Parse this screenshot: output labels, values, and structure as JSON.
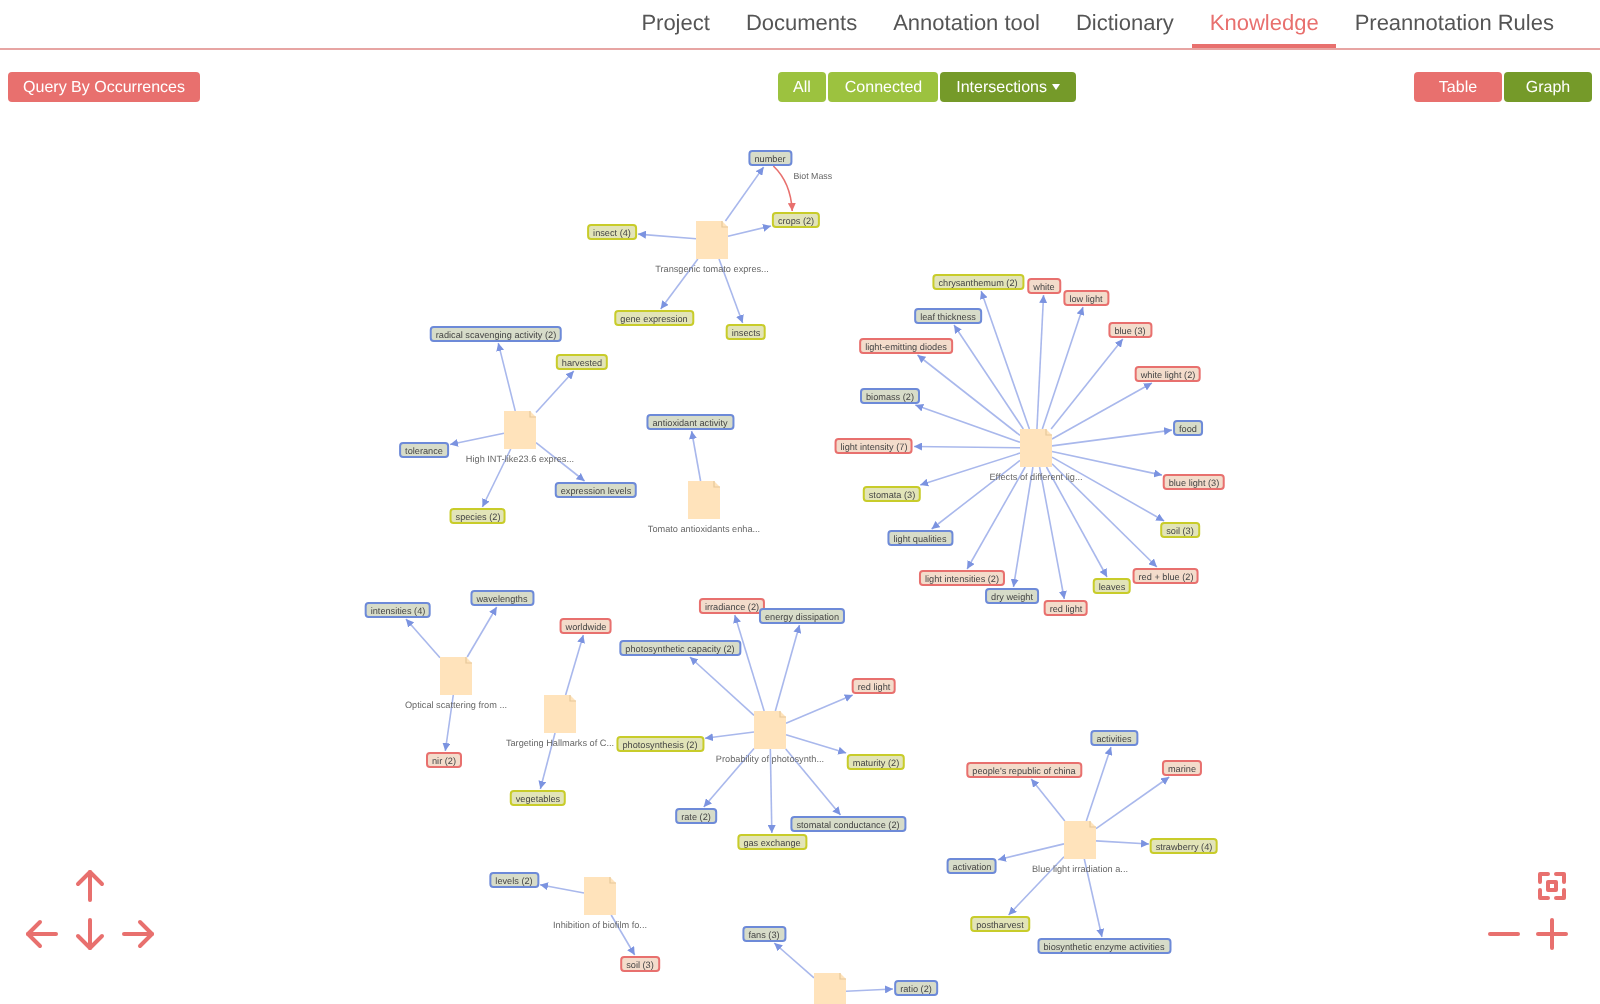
{
  "nav": {
    "tabs": [
      {
        "label": "Project",
        "selected": false
      },
      {
        "label": "Documents",
        "selected": false
      },
      {
        "label": "Annotation tool",
        "selected": false
      },
      {
        "label": "Dictionary",
        "selected": false
      },
      {
        "label": "Knowledge",
        "selected": true
      },
      {
        "label": "Preannotation Rules",
        "selected": false
      }
    ]
  },
  "toolbar": {
    "query_button": "Query By Occurrences",
    "filters": [
      {
        "label": "All",
        "selected": false,
        "dropdown": false
      },
      {
        "label": "Connected",
        "selected": false,
        "dropdown": false
      },
      {
        "label": "Intersections",
        "selected": true,
        "dropdown": true
      }
    ],
    "views": [
      {
        "label": "Table",
        "selected": false
      },
      {
        "label": "Graph",
        "selected": true
      }
    ]
  },
  "graph": {
    "documents": [
      {
        "caption": "Transgenic tomato expres...",
        "tags": [
          {
            "label": "number",
            "color": "#6d8ad8"
          },
          {
            "label": "crops (2)",
            "color": "#c8cc2a"
          },
          {
            "label": "insect (4)",
            "color": "#c8cc2a"
          },
          {
            "label": "gene expression",
            "color": "#c8cc2a"
          },
          {
            "label": "insects",
            "color": "#c8cc2a"
          }
        ],
        "links": [
          {
            "label": "Biot Mass"
          }
        ]
      },
      {
        "caption": "High INT-like23.6 expres...",
        "tags": [
          {
            "label": "radical scavenging activity (2)",
            "color": "#6d8ad8"
          },
          {
            "label": "harvested",
            "color": "#c8cc2a"
          },
          {
            "label": "tolerance",
            "color": "#6d8ad8"
          },
          {
            "label": "expression levels",
            "color": "#6d8ad8"
          },
          {
            "label": "species (2)",
            "color": "#c8cc2a"
          }
        ]
      },
      {
        "caption": "Tomato antioxidants enha...",
        "tags": [
          {
            "label": "antioxidant activity",
            "color": "#6d8ad8"
          }
        ]
      },
      {
        "caption": "Effects of different lig...",
        "tags": [
          {
            "label": "chrysanthemum (2)",
            "color": "#c8cc2a"
          },
          {
            "label": "white",
            "color": "#e8706e"
          },
          {
            "label": "low light",
            "color": "#e8706e"
          },
          {
            "label": "leaf thickness",
            "color": "#6d8ad8"
          },
          {
            "label": "blue (3)",
            "color": "#e8706e"
          },
          {
            "label": "light-emitting diodes",
            "color": "#e8706e"
          },
          {
            "label": "white light (2)",
            "color": "#e8706e"
          },
          {
            "label": "biomass (2)",
            "color": "#6d8ad8"
          },
          {
            "label": "food",
            "color": "#6d8ad8"
          },
          {
            "label": "light intensity (7)",
            "color": "#e8706e"
          },
          {
            "label": "blue light (3)",
            "color": "#e8706e"
          },
          {
            "label": "stomata (3)",
            "color": "#c8cc2a"
          },
          {
            "label": "soil (3)",
            "color": "#c8cc2a"
          },
          {
            "label": "light qualities",
            "color": "#6d8ad8"
          },
          {
            "label": "red + blue (2)",
            "color": "#e8706e"
          },
          {
            "label": "light intensities (2)",
            "color": "#e8706e"
          },
          {
            "label": "leaves",
            "color": "#c8cc2a"
          },
          {
            "label": "dry weight",
            "color": "#6d8ad8"
          },
          {
            "label": "red light",
            "color": "#e8706e"
          }
        ]
      },
      {
        "caption": "Optical scattering from ...",
        "tags": [
          {
            "label": "intensities (4)",
            "color": "#6d8ad8"
          },
          {
            "label": "wavelengths",
            "color": "#6d8ad8"
          },
          {
            "label": "nir (2)",
            "color": "#e8706e"
          }
        ]
      },
      {
        "caption": "Targeting Hallmarks of C...",
        "tags": [
          {
            "label": "worldwide",
            "color": "#e8706e"
          },
          {
            "label": "vegetables",
            "color": "#c8cc2a"
          }
        ]
      },
      {
        "caption": "Probability of photosynth...",
        "tags": [
          {
            "label": "irradiance (2)",
            "color": "#e8706e"
          },
          {
            "label": "energy dissipation",
            "color": "#6d8ad8"
          },
          {
            "label": "photosynthetic capacity (2)",
            "color": "#6d8ad8"
          },
          {
            "label": "red light",
            "color": "#e8706e"
          },
          {
            "label": "photosynthesis (2)",
            "color": "#c8cc2a"
          },
          {
            "label": "maturity (2)",
            "color": "#c8cc2a"
          },
          {
            "label": "rate (2)",
            "color": "#6d8ad8"
          },
          {
            "label": "gas exchange",
            "color": "#c8cc2a"
          },
          {
            "label": "stomatal conductance (2)",
            "color": "#6d8ad8"
          }
        ]
      },
      {
        "caption": "Blue light irradiation a...",
        "tags": [
          {
            "label": "activities",
            "color": "#6d8ad8"
          },
          {
            "label": "people's republic of china",
            "color": "#e8706e"
          },
          {
            "label": "marine",
            "color": "#e8706e"
          },
          {
            "label": "strawberry (4)",
            "color": "#c8cc2a"
          },
          {
            "label": "activation",
            "color": "#6d8ad8"
          },
          {
            "label": "postharvest",
            "color": "#c8cc2a"
          },
          {
            "label": "biosynthetic enzyme activities",
            "color": "#6d8ad8"
          }
        ]
      },
      {
        "caption": "Inhibition of biofilm fo...",
        "tags": [
          {
            "label": "levels (2)",
            "color": "#6d8ad8"
          },
          {
            "label": "soil (3)",
            "color": "#e8706e"
          }
        ]
      },
      {
        "tags": [
          {
            "label": "fans (3)",
            "color": "#6d8ad8"
          },
          {
            "label": "ratio (2)",
            "color": "#6d8ad8"
          }
        ]
      }
    ]
  }
}
